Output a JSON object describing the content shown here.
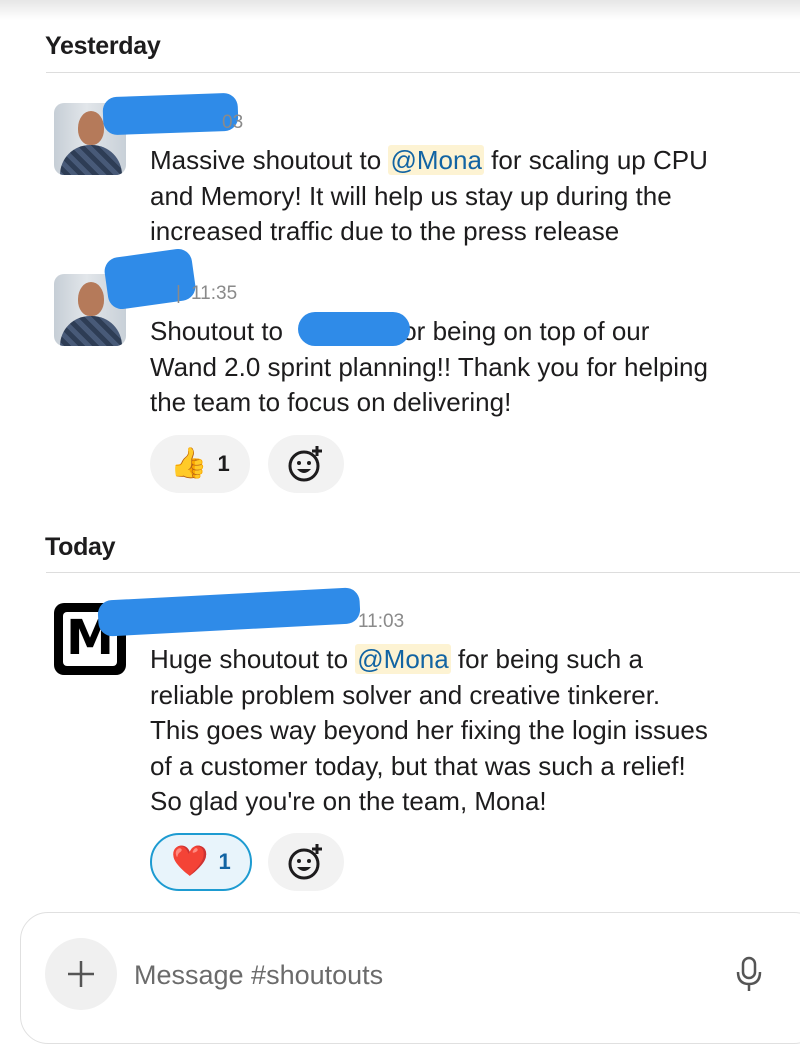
{
  "sections": [
    {
      "label": "Yesterday"
    },
    {
      "label": "Today"
    }
  ],
  "messages": [
    {
      "time": "03",
      "line1_before": "Massive shoutout to ",
      "mention": "@Mona",
      "line1_after": " for scaling up CPU",
      "lines": [
        "and Memory! It will help us stay up during the",
        "increased traffic due to the press release"
      ]
    },
    {
      "time": "11:35",
      "line1_before": "Shoutout to",
      "line1_after": "for being on top of our",
      "lines": [
        "Wand 2.0 sprint planning!! Thank you for helping",
        "the team to focus on delivering!"
      ],
      "reaction": {
        "emoji": "👍",
        "count": "1"
      }
    },
    {
      "time": "11:03",
      "line1_before": "Huge shoutout to ",
      "mention": "@Mona",
      "line1_after": " for being such a",
      "lines": [
        "reliable problem solver and creative tinkerer.",
        "This goes way beyond her fixing the login issues",
        "of a customer today, but that was such a relief!",
        "So glad you're on the team, Mona!"
      ],
      "reaction": {
        "emoji": "❤️",
        "count": "1"
      }
    }
  ],
  "composer": {
    "placeholder": "Message #shoutouts",
    "add_icon": "plus-icon",
    "mic_icon": "microphone-icon"
  },
  "colors": {
    "mention_bg": "#fdf3d3",
    "mention_text": "#1264a3",
    "redaction": "#2f8be8",
    "active_reaction_border": "#1d9bd1"
  }
}
